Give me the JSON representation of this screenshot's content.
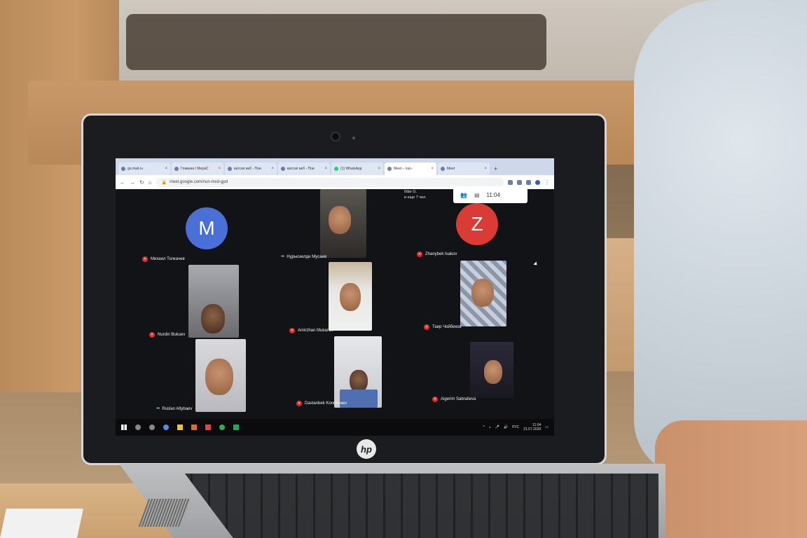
{
  "browser": {
    "tabs": [
      {
        "label": "go.mail.ru"
      },
      {
        "label": "Главная / МераС"
      },
      {
        "label": "ватсап веб - Пои"
      },
      {
        "label": "ватсап веб - Пои"
      },
      {
        "label": "(1) WhatsApp"
      },
      {
        "label": "Meet – nun-"
      },
      {
        "label": "Meet"
      }
    ],
    "new_tab": "+",
    "url": "meet.google.com/nun-mxd-gpd"
  },
  "meet": {
    "more_participants_name": "Ildar G.",
    "more_participants_text": "и еще 7 чел.",
    "clock": "11:04",
    "participants": [
      {
        "name": "Михаил Толкачев",
        "avatar_letter": "M",
        "color": "#4a6fd6"
      },
      {
        "name": "Нұрыскелди Мусаев"
      },
      {
        "name": "Zhanybek Isakov",
        "avatar_letter": "Z",
        "color": "#d93b35"
      },
      {
        "name": "Nurdin Bukuev"
      },
      {
        "name": "Amirzhan Mukanov"
      },
      {
        "name": "Таир Чойбеков"
      },
      {
        "name": "Ruslan Altybaev"
      },
      {
        "name": "Dastanbek Konokbaev"
      },
      {
        "name": "Aigerim Sabralieva"
      }
    ]
  },
  "taskbar": {
    "tray_lang": "РУС",
    "time": "11:04",
    "date": "21.07.2020"
  },
  "laptop": {
    "brand": "hp"
  }
}
